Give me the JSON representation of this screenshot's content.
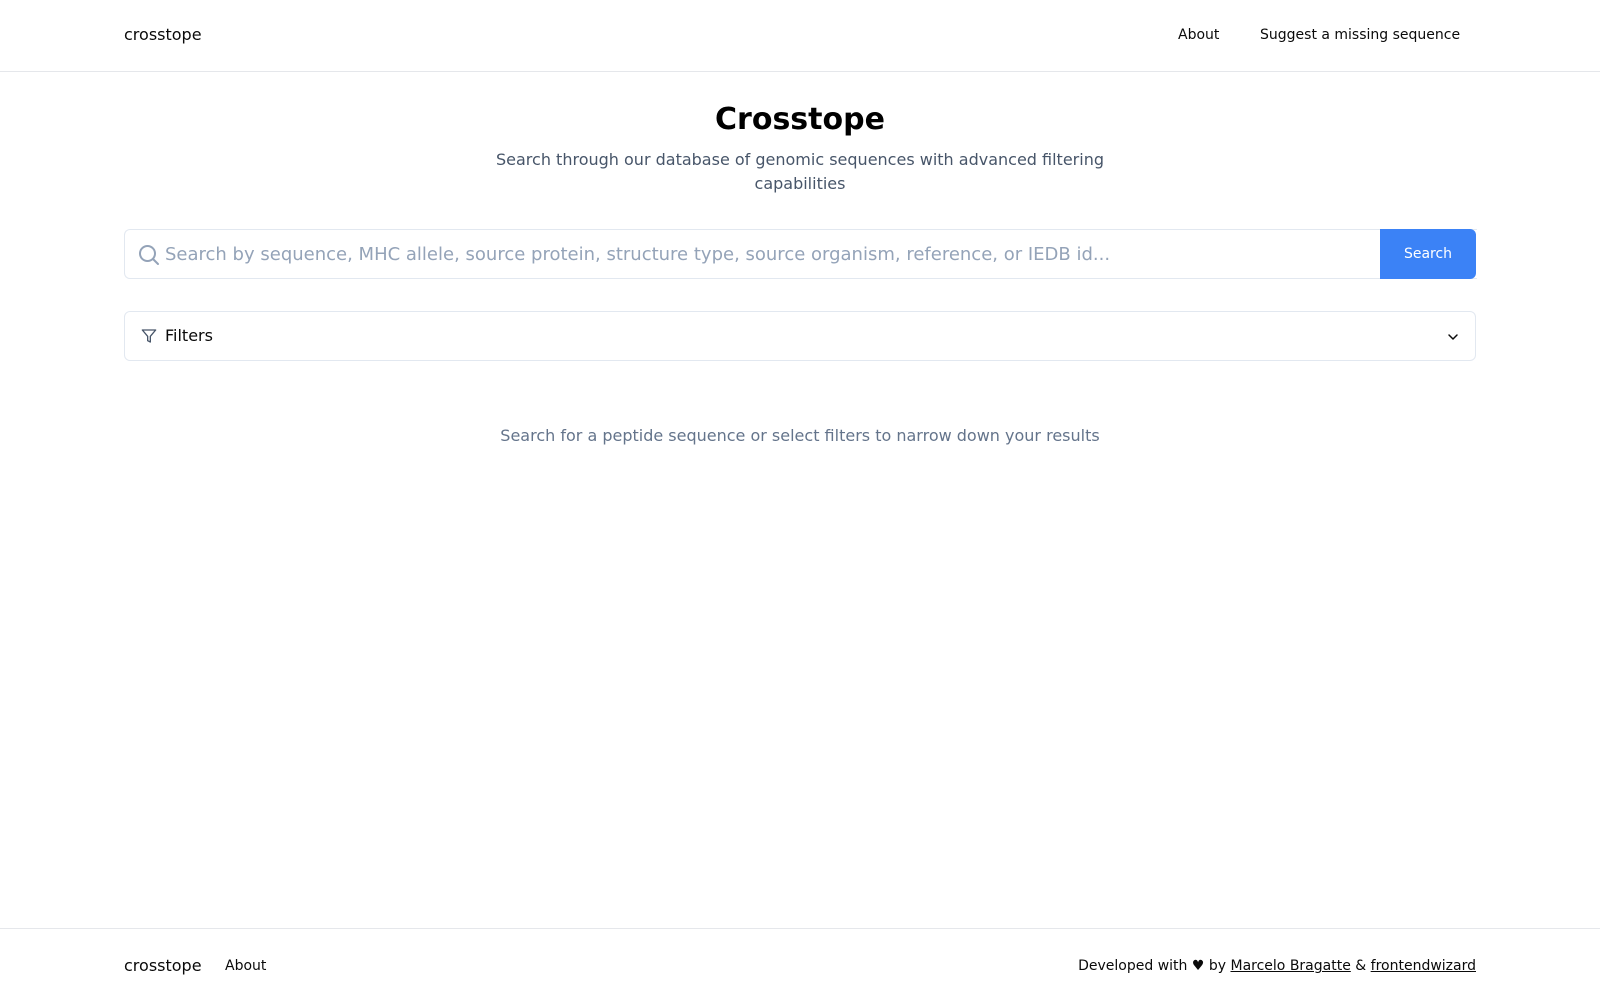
{
  "header": {
    "brand": "crosstope",
    "nav": {
      "about": "About",
      "suggest": "Suggest a missing sequence"
    }
  },
  "hero": {
    "title": "Crosstope",
    "subtitle": "Search through our database of genomic sequences with advanced filtering capabilities"
  },
  "search": {
    "placeholder": "Search by sequence, MHC allele, source protein, structure type, source organism, reference, or IEDB id...",
    "value": "",
    "button_label": "Search",
    "icon": "search-icon"
  },
  "filters": {
    "label": "Filters",
    "icon": "filter-icon",
    "toggle_icon": "chevron-down-icon",
    "expanded": false
  },
  "empty_state": {
    "message": "Search for a peptide sequence or select filters to narrow down your results"
  },
  "footer": {
    "brand": "crosstope",
    "about": "About",
    "credits_prefix": "Developed with",
    "heart": "♥",
    "by": "by",
    "author1": "Marcelo Bragatte",
    "amp": "&",
    "author2": "frontendwizard"
  },
  "colors": {
    "accent": "#3b82f6",
    "muted_text": "#64748b",
    "border": "#e2e8f0"
  }
}
